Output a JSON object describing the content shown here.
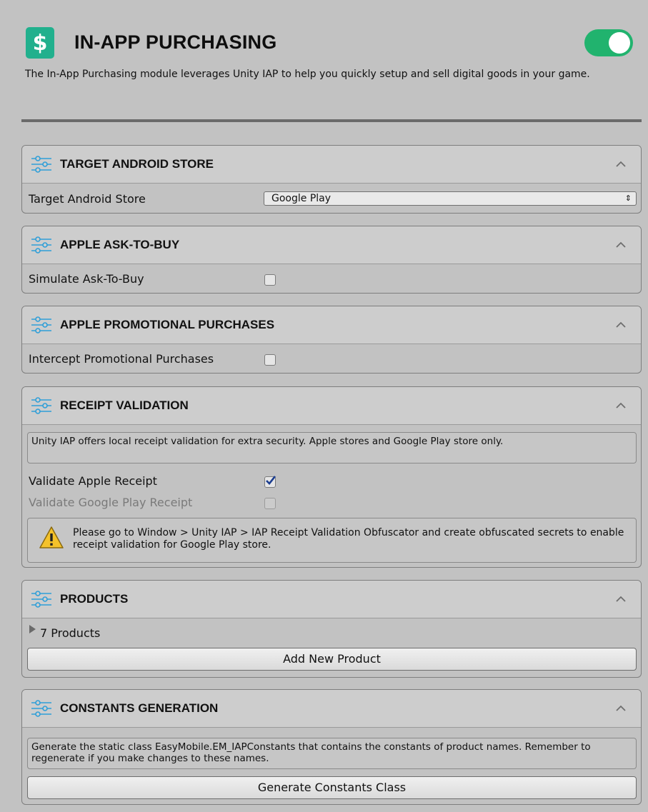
{
  "header": {
    "icon_glyph": "$",
    "title": "IN-APP PURCHASING",
    "description": "The In-App Purchasing module leverages Unity IAP to help you quickly setup and sell digital goods in your game.",
    "enabled": true,
    "accent": "#21b08d"
  },
  "sections": {
    "target_android_store": {
      "title": "TARGET ANDROID STORE",
      "label": "Target Android Store",
      "selected": "Google Play"
    },
    "apple_ask_to_buy": {
      "title": "APPLE ASK-TO-BUY",
      "label": "Simulate Ask-To-Buy",
      "checked": false
    },
    "apple_promotional": {
      "title": "APPLE PROMOTIONAL PURCHASES",
      "label": "Intercept Promotional Purchases",
      "checked": false
    },
    "receipt_validation": {
      "title": "RECEIPT VALIDATION",
      "info": "Unity IAP offers local receipt validation for extra security. Apple stores and Google Play store only.",
      "apple_label": "Validate Apple Receipt",
      "apple_checked": true,
      "google_label": "Validate Google Play Receipt",
      "google_checked": false,
      "warning": "Please go to Window > Unity IAP > IAP Receipt Validation Obfuscator and create obfuscated secrets to enable receipt validation for Google Play store."
    },
    "products": {
      "title": "PRODUCTS",
      "foldout_label": "7 Products",
      "button_label": "Add New Product"
    },
    "constants_generation": {
      "title": "CONSTANTS GENERATION",
      "info": "Generate the static class EasyMobile.EM_IAPConstants that contains the constants of product names. Remember to regenerate if you make changes to these names.",
      "button_label": "Generate Constants Class"
    }
  },
  "icons": {
    "section": "sliders-icon",
    "collapse": "chevron-up-icon",
    "warning": "warning-icon"
  }
}
